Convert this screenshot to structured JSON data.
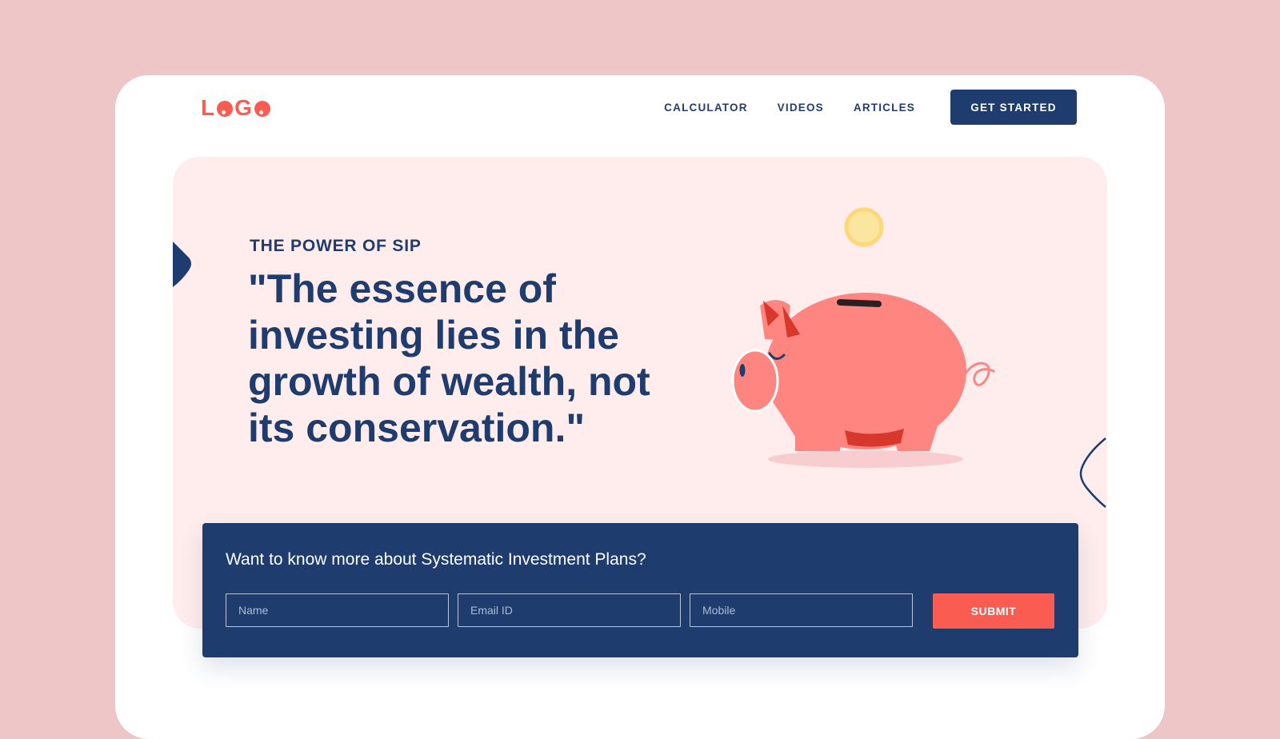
{
  "brand": {
    "logo_text": "LOGO"
  },
  "nav": {
    "items": [
      "CALCULATOR",
      "VIDEOS",
      "ARTICLES"
    ],
    "cta_label": "GET STARTED"
  },
  "hero": {
    "eyebrow": "THE POWER OF SIP",
    "quote": "\"The essence of investing lies in the growth of wealth, not its conservation.\""
  },
  "form": {
    "title": "Want to know more about Systematic Investment Plans?",
    "name_placeholder": "Name",
    "email_placeholder": "Email ID",
    "mobile_placeholder": "Mobile",
    "submit_label": "SUBMIT"
  },
  "colors": {
    "accent": "#fb5c52",
    "navy": "#1f3c6e",
    "hero_bg": "#ffeded",
    "page_bg": "#efc6c8"
  },
  "icons": [
    "piggy-bank-icon",
    "coin-icon"
  ]
}
